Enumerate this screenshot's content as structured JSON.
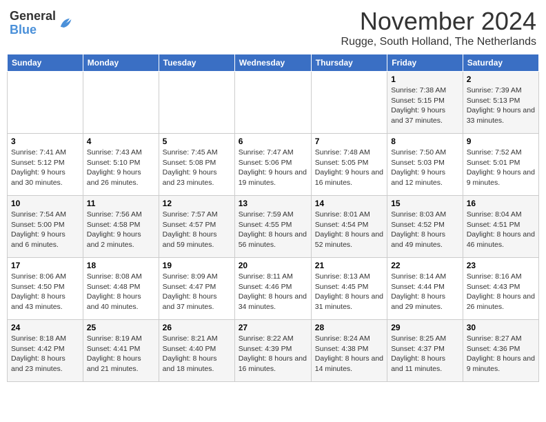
{
  "logo": {
    "general": "General",
    "blue": "Blue"
  },
  "title": "November 2024",
  "location": "Rugge, South Holland, The Netherlands",
  "header_days": [
    "Sunday",
    "Monday",
    "Tuesday",
    "Wednesday",
    "Thursday",
    "Friday",
    "Saturday"
  ],
  "weeks": [
    [
      {
        "day": "",
        "info": ""
      },
      {
        "day": "",
        "info": ""
      },
      {
        "day": "",
        "info": ""
      },
      {
        "day": "",
        "info": ""
      },
      {
        "day": "",
        "info": ""
      },
      {
        "day": "1",
        "info": "Sunrise: 7:38 AM\nSunset: 5:15 PM\nDaylight: 9 hours and 37 minutes."
      },
      {
        "day": "2",
        "info": "Sunrise: 7:39 AM\nSunset: 5:13 PM\nDaylight: 9 hours and 33 minutes."
      }
    ],
    [
      {
        "day": "3",
        "info": "Sunrise: 7:41 AM\nSunset: 5:12 PM\nDaylight: 9 hours and 30 minutes."
      },
      {
        "day": "4",
        "info": "Sunrise: 7:43 AM\nSunset: 5:10 PM\nDaylight: 9 hours and 26 minutes."
      },
      {
        "day": "5",
        "info": "Sunrise: 7:45 AM\nSunset: 5:08 PM\nDaylight: 9 hours and 23 minutes."
      },
      {
        "day": "6",
        "info": "Sunrise: 7:47 AM\nSunset: 5:06 PM\nDaylight: 9 hours and 19 minutes."
      },
      {
        "day": "7",
        "info": "Sunrise: 7:48 AM\nSunset: 5:05 PM\nDaylight: 9 hours and 16 minutes."
      },
      {
        "day": "8",
        "info": "Sunrise: 7:50 AM\nSunset: 5:03 PM\nDaylight: 9 hours and 12 minutes."
      },
      {
        "day": "9",
        "info": "Sunrise: 7:52 AM\nSunset: 5:01 PM\nDaylight: 9 hours and 9 minutes."
      }
    ],
    [
      {
        "day": "10",
        "info": "Sunrise: 7:54 AM\nSunset: 5:00 PM\nDaylight: 9 hours and 6 minutes."
      },
      {
        "day": "11",
        "info": "Sunrise: 7:56 AM\nSunset: 4:58 PM\nDaylight: 9 hours and 2 minutes."
      },
      {
        "day": "12",
        "info": "Sunrise: 7:57 AM\nSunset: 4:57 PM\nDaylight: 8 hours and 59 minutes."
      },
      {
        "day": "13",
        "info": "Sunrise: 7:59 AM\nSunset: 4:55 PM\nDaylight: 8 hours and 56 minutes."
      },
      {
        "day": "14",
        "info": "Sunrise: 8:01 AM\nSunset: 4:54 PM\nDaylight: 8 hours and 52 minutes."
      },
      {
        "day": "15",
        "info": "Sunrise: 8:03 AM\nSunset: 4:52 PM\nDaylight: 8 hours and 49 minutes."
      },
      {
        "day": "16",
        "info": "Sunrise: 8:04 AM\nSunset: 4:51 PM\nDaylight: 8 hours and 46 minutes."
      }
    ],
    [
      {
        "day": "17",
        "info": "Sunrise: 8:06 AM\nSunset: 4:50 PM\nDaylight: 8 hours and 43 minutes."
      },
      {
        "day": "18",
        "info": "Sunrise: 8:08 AM\nSunset: 4:48 PM\nDaylight: 8 hours and 40 minutes."
      },
      {
        "day": "19",
        "info": "Sunrise: 8:09 AM\nSunset: 4:47 PM\nDaylight: 8 hours and 37 minutes."
      },
      {
        "day": "20",
        "info": "Sunrise: 8:11 AM\nSunset: 4:46 PM\nDaylight: 8 hours and 34 minutes."
      },
      {
        "day": "21",
        "info": "Sunrise: 8:13 AM\nSunset: 4:45 PM\nDaylight: 8 hours and 31 minutes."
      },
      {
        "day": "22",
        "info": "Sunrise: 8:14 AM\nSunset: 4:44 PM\nDaylight: 8 hours and 29 minutes."
      },
      {
        "day": "23",
        "info": "Sunrise: 8:16 AM\nSunset: 4:43 PM\nDaylight: 8 hours and 26 minutes."
      }
    ],
    [
      {
        "day": "24",
        "info": "Sunrise: 8:18 AM\nSunset: 4:42 PM\nDaylight: 8 hours and 23 minutes."
      },
      {
        "day": "25",
        "info": "Sunrise: 8:19 AM\nSunset: 4:41 PM\nDaylight: 8 hours and 21 minutes."
      },
      {
        "day": "26",
        "info": "Sunrise: 8:21 AM\nSunset: 4:40 PM\nDaylight: 8 hours and 18 minutes."
      },
      {
        "day": "27",
        "info": "Sunrise: 8:22 AM\nSunset: 4:39 PM\nDaylight: 8 hours and 16 minutes."
      },
      {
        "day": "28",
        "info": "Sunrise: 8:24 AM\nSunset: 4:38 PM\nDaylight: 8 hours and 14 minutes."
      },
      {
        "day": "29",
        "info": "Sunrise: 8:25 AM\nSunset: 4:37 PM\nDaylight: 8 hours and 11 minutes."
      },
      {
        "day": "30",
        "info": "Sunrise: 8:27 AM\nSunset: 4:36 PM\nDaylight: 8 hours and 9 minutes."
      }
    ]
  ]
}
